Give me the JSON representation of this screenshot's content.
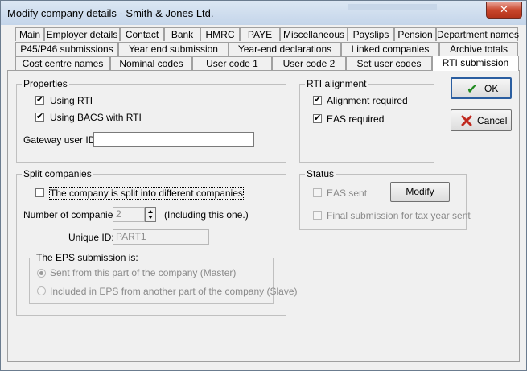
{
  "window": {
    "title": "Modify company details - Smith & Jones Ltd.",
    "close_glyph": "✕"
  },
  "tabs_row1": [
    "Main",
    "Employer details",
    "Contact",
    "Bank",
    "HMRC",
    "PAYE",
    "Miscellaneous",
    "Payslips",
    "Pension",
    "Department names"
  ],
  "tabs_row2": [
    "P45/P46 submissions",
    "Year end submission",
    "Year-end declarations",
    "Linked companies",
    "Archive totals"
  ],
  "tabs_row3": [
    "Cost centre names",
    "Nominal codes",
    "User code 1",
    "User code 2",
    "Set user codes",
    "RTI submission"
  ],
  "properties": {
    "title": "Properties",
    "using_rti": "Using RTI",
    "using_bacs": "Using BACS with RTI",
    "gateway_label": "Gateway user ID:",
    "gateway_value": ""
  },
  "rti_alignment": {
    "title": "RTI alignment",
    "alignment_required": "Alignment required",
    "eas_required": "EAS required"
  },
  "buttons": {
    "ok": "OK",
    "cancel": "Cancel",
    "modify": "Modify"
  },
  "split": {
    "title": "Split companies",
    "split_label": "The company is split into different companies",
    "number_label": "Number of companies:",
    "number_value": "2",
    "including": "(Including this one.)",
    "unique_label": "Unique ID:",
    "unique_value": "PART1",
    "eps_title": "The EPS submission is:",
    "eps_master": "Sent from this part of the company (Master)",
    "eps_slave": "Included in EPS from another part of the company (Slave)"
  },
  "status": {
    "title": "Status",
    "eas_sent": "EAS sent",
    "final_submission": "Final submission for tax year sent"
  },
  "checkmark": "✔"
}
